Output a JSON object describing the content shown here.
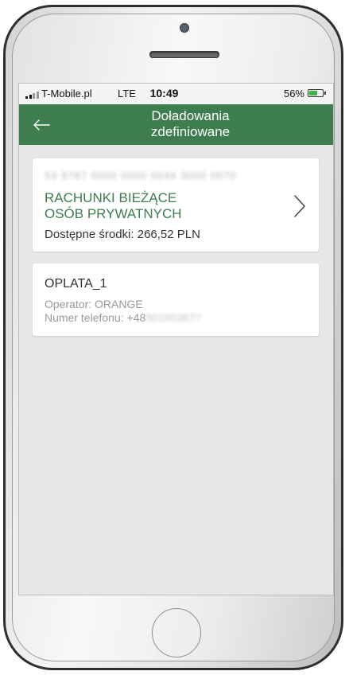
{
  "status_bar": {
    "carrier": "T-Mobile.pl",
    "network": "LTE",
    "time": "10:49",
    "battery_percent": "56%"
  },
  "app_bar": {
    "title_line1": "Doładowania",
    "title_line2": "zdefiniowane",
    "back_icon": "arrow-left-icon",
    "color": "#3e7d4e"
  },
  "account": {
    "number_redacted": "53 8787 0000 0000 0044 3000 0070",
    "name": "RACHUNKI BIEŻĄCE\nOSÓB PRYWATNYCH",
    "funds_label": "Dostępne środki: 266,52 PLN",
    "chevron_icon": "chevron-right-icon"
  },
  "topups": [
    {
      "name": "OPLATA_1",
      "operator_label": "Operator: ORANGE",
      "phone_prefix": "Numer telefonu: +48",
      "phone_redacted": "501953677"
    }
  ]
}
